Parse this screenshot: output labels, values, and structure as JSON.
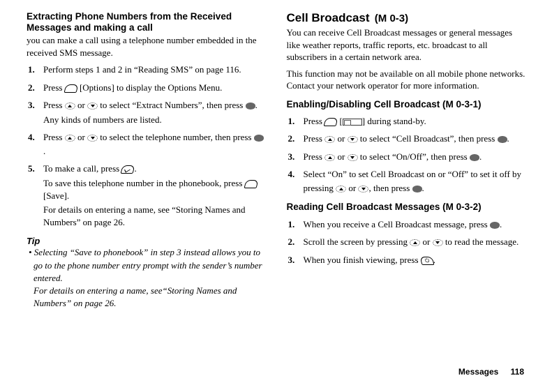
{
  "left": {
    "heading_l1": "Extracting Phone Numbers from the Received",
    "heading_l2": "Messages and making a call",
    "intro": "you can make a call using a telephone number embedded in the received SMS message.",
    "steps": {
      "s1": "Perform steps 1 and 2 in “Reading SMS” on page 116.",
      "s2a": "Press ",
      "s2b": " [Options] to display the Options Menu.",
      "s3a": "Press ",
      "s3or": " or ",
      "s3b": " to select “Extract Numbers”, then press ",
      "s3c": ".",
      "s3sub": "Any kinds of numbers are listed.",
      "s4a": "Press  ",
      "s4b": " to select the telephone number, then press ",
      "s4c": ".",
      "s5a": "To make a call, press ",
      "s5b": ".",
      "s5sub1": "To save this telephone number in the phonebook, press ",
      "s5sub1b": " [Save].",
      "s5sub2": "For details on entering a name, see “Storing Names and Numbers” on page 26."
    },
    "tip_label": "Tip",
    "tip1": "• Selecting “Save to phonebook” in step 3 instead allows you to go to the phone number entry prompt with the sender’s number entered.",
    "tip2": "For details on entering a name, see“Storing Names and Numbers” on page 26."
  },
  "right": {
    "title": "Cell Broadcast",
    "menu": "(M 0-3)",
    "para1": "You can receive Cell Broadcast messages or general messages like weather reports, traffic reports, etc. broadcast to all subscribers in a certain network area.",
    "para2": "This function may not be available on all mobile phone networks. Contact your network operator for more information.",
    "sub1": "Enabling/Disabling Cell Broadcast (M 0-3-1)",
    "s1a": "Press ",
    "s1b": " [",
    "s1c": "] during stand-by.",
    "s2a": "Press ",
    "s2b": " to select “Cell Broadcast”, then press ",
    "s2c": ".",
    "s3a": "Press ",
    "s3b": " to select “On/Off”, then press ",
    "s3c": ".",
    "s4a": "Select “On” to set Cell Broadcast on or “Off” to set it off by pressing ",
    "s4b": ", then press ",
    "s4c": ".",
    "sub2": "Reading Cell Broadcast Messages (M 0-3-2)",
    "r1a": "When you receive a Cell Broadcast message, press ",
    "r1b": ".",
    "r2a": "Scroll the screen by pressing ",
    "r2b": " to read the message.",
    "r3a": "When you finish viewing, press ",
    "r3b": "."
  },
  "footer": {
    "label": "Messages",
    "page": "118"
  },
  "or": " or "
}
